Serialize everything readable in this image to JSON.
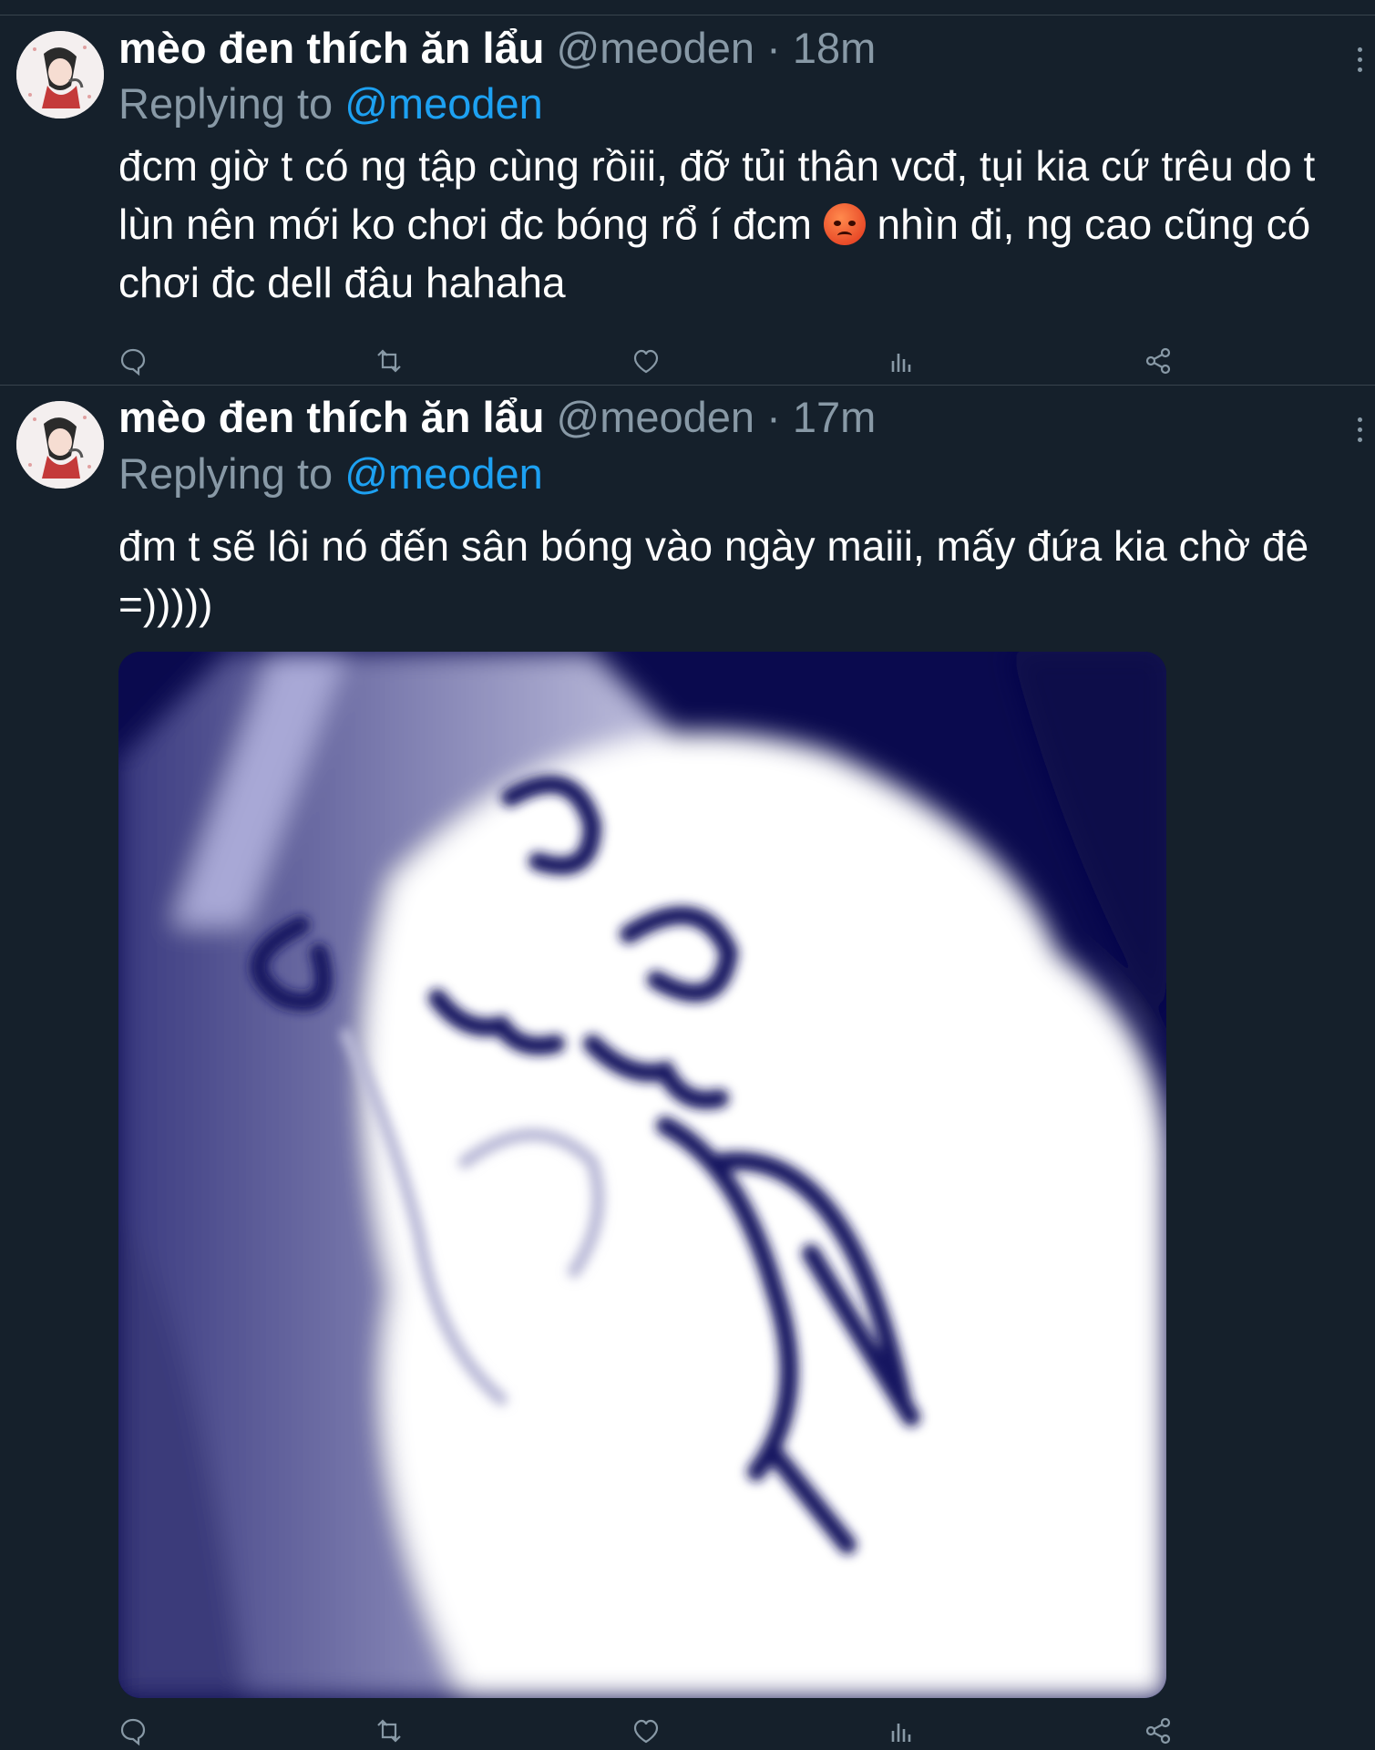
{
  "colors": {
    "background": "#15202b",
    "divider": "#38444d",
    "secondary_text": "#8899a6",
    "link": "#1da1f2",
    "primary_text": "#ffffff"
  },
  "tweets": [
    {
      "name": "mèo đen thích ăn lẩu",
      "handle": "@meoden",
      "separator": "·",
      "time": "18m",
      "replying_prefix": "Replying to",
      "replying_handle": "@meoden",
      "text_part1": "đcm giờ t có ng tập cùng rồiii, đỡ tủi thân vcđ, tụi kia cứ trêu do t lùn nên mới ko chơi đc bóng rổ í đcm",
      "emoji": "pouting-face",
      "text_part2": "nhìn đi, ng cao cũng có chơi đc dell đâu hahaha",
      "icons": [
        "reply-icon",
        "retweet-icon",
        "like-icon",
        "analytics-icon",
        "share-icon",
        "more-icon"
      ]
    },
    {
      "name": "mèo đen thích ăn lẩu",
      "handle": "@meoden",
      "separator": "·",
      "time": "17m",
      "replying_prefix": "Replying to",
      "replying_handle": "@meoden",
      "text": "đm t sẽ lôi nó đến sân bóng vào ngày maiii, mấy đứa kia chờ đê =)))))",
      "media": "blurred cat meme image",
      "icons": [
        "reply-icon",
        "retweet-icon",
        "like-icon",
        "analytics-icon",
        "share-icon",
        "more-icon"
      ]
    }
  ]
}
